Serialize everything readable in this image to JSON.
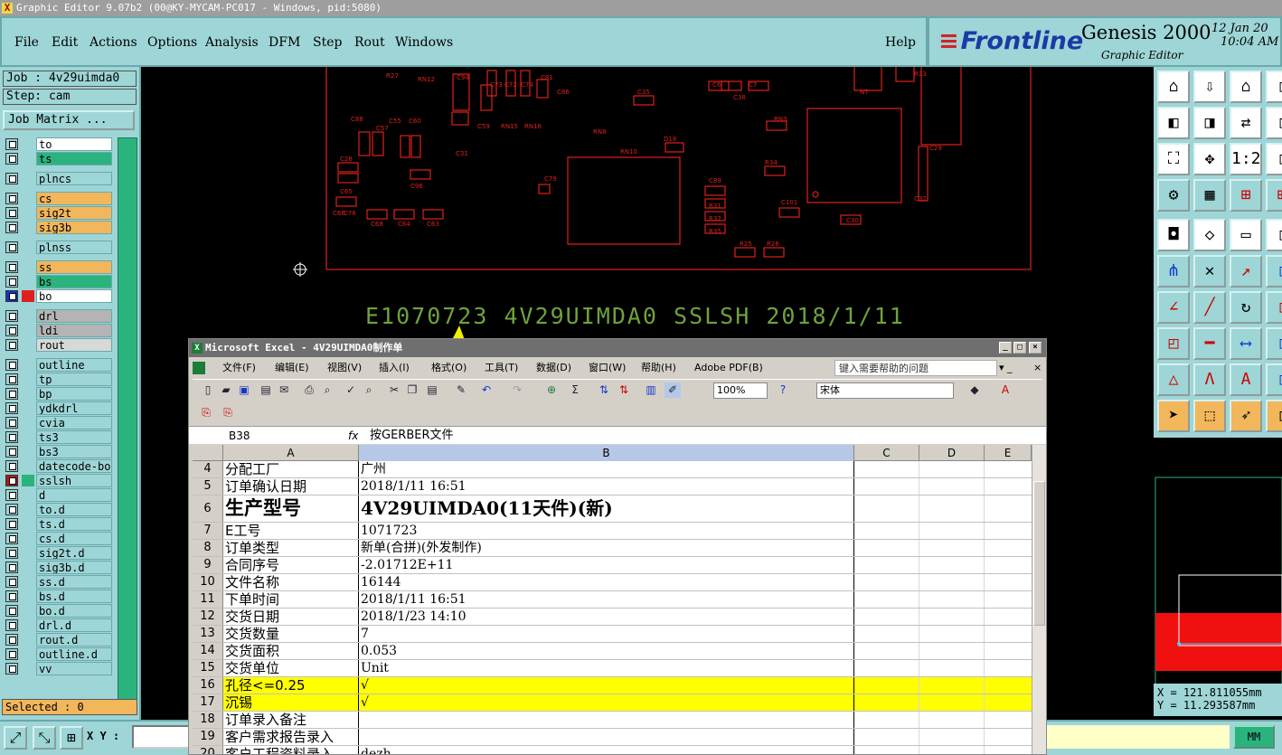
{
  "window": {
    "title": "Graphic Editor 9.07b2 (00@KY-MYCAM-PC017 - Windows, pid:5080)"
  },
  "menu": [
    "File",
    "Edit",
    "Actions",
    "Options",
    "Analysis",
    "DFM",
    "Step",
    "Rout",
    "Windows"
  ],
  "help_label": "Help",
  "brand": {
    "logo": "Frontline",
    "product": "Genesis 2000",
    "subtitle": "Graphic Editor",
    "date": "12 Jan 20",
    "time": "10:04 AM"
  },
  "job": {
    "job_label": "Job : 4v29uimda0",
    "step_label": "Step: cam",
    "matrix_button": "Job Matrix ..."
  },
  "layers": [
    {
      "name": "to",
      "color": "#ffffff"
    },
    {
      "name": "ts",
      "color": "#2bb37e"
    },
    {
      "name": "plncs",
      "color": "#9ed5d6"
    },
    {
      "name": "cs",
      "color": "#f2b65b"
    },
    {
      "name": "sig2t",
      "color": "#f2b65b"
    },
    {
      "name": "sig3b",
      "color": "#f2b65b"
    },
    {
      "name": "plnss",
      "color": "#9ed5d6"
    },
    {
      "name": "ss",
      "color": "#f2b65b"
    },
    {
      "name": "bs",
      "color": "#2bb37e"
    },
    {
      "name": "bo",
      "color": "#ffffff",
      "active": true
    },
    {
      "name": "drl",
      "color": "#b4b4b4"
    },
    {
      "name": "ldi",
      "color": "#b4b4b4"
    },
    {
      "name": "rout",
      "color": "#d8d8d8"
    },
    {
      "name": "outline",
      "color": "#9ed5d6"
    },
    {
      "name": "tp",
      "color": "#9ed5d6"
    },
    {
      "name": "bp",
      "color": "#9ed5d6"
    },
    {
      "name": "ydkdrl",
      "color": "#9ed5d6"
    },
    {
      "name": "cvia",
      "color": "#9ed5d6"
    },
    {
      "name": "ts3",
      "color": "#9ed5d6"
    },
    {
      "name": "bs3",
      "color": "#9ed5d6"
    },
    {
      "name": "datecode-bo",
      "color": "#9ed5d6"
    },
    {
      "name": "sslsh",
      "color": "#9ed5d6",
      "marked": true
    },
    {
      "name": "d",
      "color": "#9ed5d6"
    },
    {
      "name": "to.d",
      "color": "#9ed5d6"
    },
    {
      "name": "ts.d",
      "color": "#9ed5d6"
    },
    {
      "name": "cs.d",
      "color": "#9ed5d6"
    },
    {
      "name": "sig2t.d",
      "color": "#9ed5d6"
    },
    {
      "name": "sig3b.d",
      "color": "#9ed5d6"
    },
    {
      "name": "ss.d",
      "color": "#9ed5d6"
    },
    {
      "name": "bs.d",
      "color": "#9ed5d6"
    },
    {
      "name": "bo.d",
      "color": "#9ed5d6"
    },
    {
      "name": "drl.d",
      "color": "#9ed5d6"
    },
    {
      "name": "rout.d",
      "color": "#9ed5d6"
    },
    {
      "name": "outline.d",
      "color": "#9ed5d6"
    },
    {
      "name": "vv",
      "color": "#9ed5d6"
    }
  ],
  "selected_label": "Selected : 0",
  "xy_label": "X Y :",
  "units_button": "MM",
  "coords": {
    "x": "X = 121.811055mm",
    "y": "Y = 11.293587mm"
  },
  "canvas": {
    "silk_text": "E1070723 4V29UIMDA0 SSLSH 2018/1/11",
    "silk_color": "#6fa33a",
    "trace_color": "#e0201c",
    "components": [
      "R27",
      "RN12",
      "C94",
      "C73",
      "C72",
      "C74",
      "C81",
      "C86",
      "C35",
      "C6",
      "C7",
      "N7",
      "R33",
      "C38",
      "C88",
      "C57",
      "C55",
      "C60",
      "C59",
      "RN15",
      "RN16",
      "RN8",
      "RN3",
      "C31",
      "RN10",
      "D18",
      "R34",
      "C29",
      "C32",
      "C28",
      "C89",
      "C79",
      "C96",
      "C65",
      "C76",
      "C68",
      "C64",
      "C63",
      "C66",
      "R31",
      "R32",
      "R35",
      "C101",
      "C30",
      "R25",
      "R26"
    ]
  },
  "excel": {
    "title": "Microsoft Excel - 4V29UIMDA0制作单",
    "menu": [
      "文件(F)",
      "编辑(E)",
      "视图(V)",
      "插入(I)",
      "格式(O)",
      "工具(T)",
      "数据(D)",
      "窗口(W)",
      "帮助(H)",
      "Adobe PDF(B)"
    ],
    "help_placeholder": "键入需要帮助的问题",
    "zoom": "100%",
    "font": "宋体",
    "name_box": "B38",
    "fx": "fx",
    "formula": "按GERBER文件",
    "columns": [
      "A",
      "B",
      "C",
      "D",
      "E"
    ],
    "rows": [
      {
        "num": "4",
        "a": "分配工厂",
        "b": "广州"
      },
      {
        "num": "5",
        "a": "订单确认日期",
        "b": "2018/1/11 16:51"
      },
      {
        "num": "6",
        "a": "生产型号",
        "b": "4V29UIMDA0(11天件)(新)"
      },
      {
        "num": "7",
        "a": "E工号",
        "b": "1071723"
      },
      {
        "num": "8",
        "a": "订单类型",
        "b": "新单(合拼)(外发制作)"
      },
      {
        "num": "9",
        "a": "合同序号",
        "b": "-2.01712E+11"
      },
      {
        "num": "10",
        "a": "文件名称",
        "b": "16144"
      },
      {
        "num": "11",
        "a": "下单时间",
        "b": "2018/1/11 16:51"
      },
      {
        "num": "12",
        "a": "交货日期",
        "b": "2018/1/23 14:10"
      },
      {
        "num": "13",
        "a": "交货数量",
        "b": "7"
      },
      {
        "num": "14",
        "a": "交货面积",
        "b": "0.053"
      },
      {
        "num": "15",
        "a": "交货单位",
        "b": "Unit"
      },
      {
        "num": "16",
        "a": "孔径<=0.25",
        "b": "√"
      },
      {
        "num": "17",
        "a": "沉锡",
        "b": "√"
      },
      {
        "num": "18",
        "a": "订单录入备注",
        "b": ""
      },
      {
        "num": "19",
        "a": "客户需求报告录入",
        "b": ""
      },
      {
        "num": "20",
        "a": "客户工程资料录入",
        "b": "dezh"
      }
    ]
  }
}
